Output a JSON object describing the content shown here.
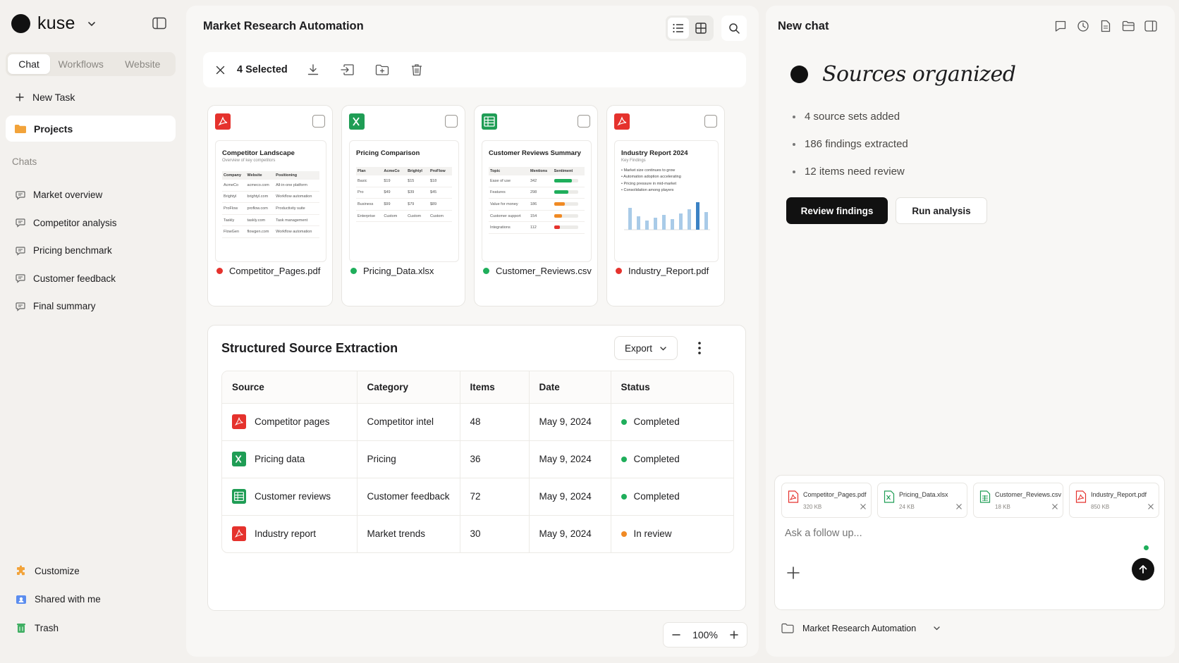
{
  "sidebar": {
    "brand": "kuse",
    "tabs": [
      "Chat",
      "Workflows",
      "Website"
    ],
    "new_task": "New Task",
    "projects": "Projects",
    "chats_label": "Chats",
    "chats": [
      "Market overview",
      "Competitor analysis",
      "Pricing benchmark",
      "Customer feedback",
      "Final summary"
    ],
    "bottom": [
      "Customize",
      "Shared with me",
      "Trash"
    ]
  },
  "main": {
    "title": "Market Research Automation",
    "selection": "4 Selected",
    "cards": [
      {
        "file": "Competitor_Pages.pdf",
        "type": "pdf",
        "dot": "#e5322d",
        "thumb_title": "Competitor Landscape",
        "thumb_sub": "Overview of key competitors",
        "head": [
          "Company",
          "Website",
          "Positioning"
        ],
        "rows": [
          [
            "AcmeCo",
            "acmeco.com",
            "All-in-one platform"
          ],
          [
            "Brightyl",
            "brightyl.com",
            "Workflow automation"
          ],
          [
            "ProFlow",
            "proflow.com",
            "Productivity suite"
          ],
          [
            "Taskly",
            "taskly.com",
            "Task management"
          ],
          [
            "FlowGen",
            "flowgen.com",
            "Workflow automation"
          ]
        ]
      },
      {
        "file": "Pricing_Data.xlsx",
        "type": "xlsx",
        "dot": "#1fae5b",
        "thumb_title": "Pricing Comparison",
        "head": [
          "Plan",
          "AcmeCo",
          "Brightyl",
          "ProFlow"
        ],
        "rows": [
          [
            "Basic",
            "$19",
            "$15",
            "$18"
          ],
          [
            "Pro",
            "$49",
            "$39",
            "$45"
          ],
          [
            "Business",
            "$99",
            "$79",
            "$89"
          ],
          [
            "Enterprise",
            "Custom",
            "Custom",
            "Custom"
          ]
        ]
      },
      {
        "file": "Customer_Reviews.csv",
        "type": "csv",
        "dot": "#1fae5b",
        "thumb_title": "Customer Reviews Summary",
        "head": [
          "Topic",
          "Mentions",
          "Sentiment"
        ],
        "rows": [
          [
            "Ease of use",
            "342"
          ],
          [
            "Features",
            "298"
          ],
          [
            "Value for money",
            "186"
          ],
          [
            "Customer support",
            "154"
          ],
          [
            "Integrations",
            "112"
          ]
        ],
        "sentiment": [
          {
            "fraction": 0.75,
            "color": "#1fae5b"
          },
          {
            "fraction": 0.6,
            "color": "#1fae5b"
          },
          {
            "fraction": 0.45,
            "color": "#f08a24"
          },
          {
            "fraction": 0.35,
            "color": "#f08a24"
          },
          {
            "fraction": 0.25,
            "color": "#e5322d"
          }
        ]
      },
      {
        "file": "Industry_Report.pdf",
        "type": "pdf",
        "dot": "#e5322d",
        "thumb_title": "Industry Report 2024",
        "thumb_sub": "Key Findings",
        "bullets": [
          "Market size continues to grow",
          "Automation adoption accelerating",
          "Pricing pressure in mid-market",
          "Consolidation among players"
        ]
      }
    ],
    "extraction": {
      "title": "Structured Source Extraction",
      "export": "Export",
      "columns": [
        "Source",
        "Category",
        "Items",
        "Date",
        "Status"
      ],
      "rows": [
        {
          "source": "Competitor pages",
          "type": "pdf",
          "category": "Competitor intel",
          "items": "48",
          "date": "May 9, 2024",
          "status": "Completed",
          "status_color": "#1fae5b"
        },
        {
          "source": "Pricing data",
          "type": "xlsx",
          "category": "Pricing",
          "items": "36",
          "date": "May 9, 2024",
          "status": "Completed",
          "status_color": "#1fae5b"
        },
        {
          "source": "Customer reviews",
          "type": "csv",
          "category": "Customer feedback",
          "items": "72",
          "date": "May 9, 2024",
          "status": "Completed",
          "status_color": "#1fae5b"
        },
        {
          "source": "Industry report",
          "type": "pdf",
          "category": "Market trends",
          "items": "30",
          "date": "May 9, 2024",
          "status": "In review",
          "status_color": "#f08a24"
        }
      ]
    },
    "zoom": "100%"
  },
  "chat": {
    "title": "New chat",
    "heading": "Sources organized",
    "bullets": [
      "4 source sets added",
      "186 findings extracted",
      "12 items need review"
    ],
    "primary_button": "Review findings",
    "secondary_button": "Run analysis",
    "attachments": [
      {
        "name": "Competitor_Pages.pdf",
        "size": "320 KB",
        "type": "pdf"
      },
      {
        "name": "Pricing_Data.xlsx",
        "size": "24 KB",
        "type": "xlsx"
      },
      {
        "name": "Customer_Reviews.csv",
        "size": "18 KB",
        "type": "csv"
      },
      {
        "name": "Industry_Report.pdf",
        "size": "850 KB",
        "type": "pdf"
      }
    ],
    "input_placeholder": "Ask a follow up...",
    "project": "Market Research Automation"
  }
}
